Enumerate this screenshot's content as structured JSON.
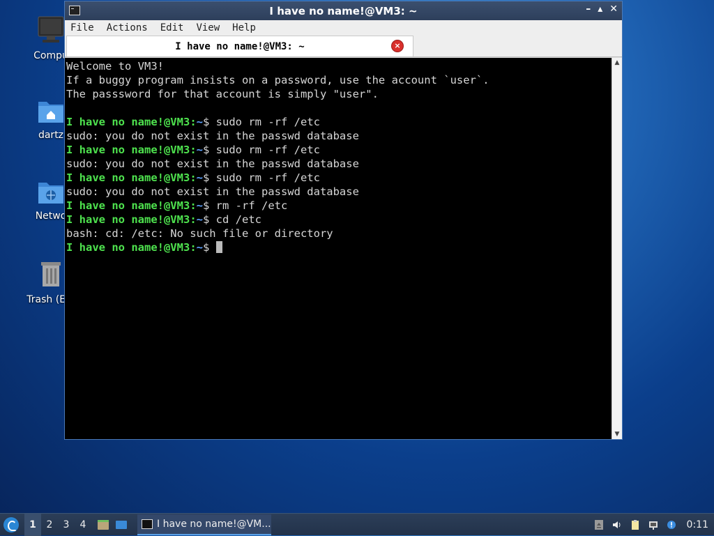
{
  "desktop": {
    "icons": [
      {
        "label": "Compu",
        "icon": "computer-icon"
      },
      {
        "label": "dartz",
        "icon": "home-folder-icon"
      },
      {
        "label": "Netwo",
        "icon": "network-folder-icon"
      },
      {
        "label": "Trash (Em",
        "icon": "trash-icon"
      }
    ]
  },
  "window": {
    "title": "I have no name!@VM3: ~",
    "buttons": {
      "minimize": "–",
      "maximize": "▴",
      "close": "✕"
    },
    "menu": [
      "File",
      "Actions",
      "Edit",
      "View",
      "Help"
    ],
    "tab": {
      "label": "I have no name!@VM3: ~",
      "close": "×"
    }
  },
  "terminal": {
    "lines": [
      {
        "type": "text",
        "text": "Welcome to VM3!"
      },
      {
        "type": "text",
        "text": "If a buggy program insists on a password, use the account `user`."
      },
      {
        "type": "text",
        "text": "The passsword for that account is simply \"user\"."
      },
      {
        "type": "text",
        "text": ""
      },
      {
        "type": "prompt",
        "user": "I have no name!@VM3",
        "path": "~",
        "cmd": "sudo rm -rf /etc"
      },
      {
        "type": "text",
        "text": "sudo: you do not exist in the passwd database"
      },
      {
        "type": "prompt",
        "user": "I have no name!@VM3",
        "path": "~",
        "cmd": "sudo rm -rf /etc"
      },
      {
        "type": "text",
        "text": "sudo: you do not exist in the passwd database"
      },
      {
        "type": "prompt",
        "user": "I have no name!@VM3",
        "path": "~",
        "cmd": "sudo rm -rf /etc"
      },
      {
        "type": "text",
        "text": "sudo: you do not exist in the passwd database"
      },
      {
        "type": "prompt",
        "user": "I have no name!@VM3",
        "path": "~",
        "cmd": "rm -rf /etc"
      },
      {
        "type": "prompt",
        "user": "I have no name!@VM3",
        "path": "~",
        "cmd": "cd /etc"
      },
      {
        "type": "text",
        "text": "bash: cd: /etc: No such file or directory"
      },
      {
        "type": "prompt",
        "user": "I have no name!@VM3",
        "path": "~",
        "cmd": "",
        "cursor": true
      }
    ],
    "colors": {
      "prompt": "#4ee24e",
      "path": "#5ea3ff",
      "text": "#d6d6d6",
      "background": "#000000"
    }
  },
  "taskbar": {
    "workspaces": [
      "1",
      "2",
      "3",
      "4"
    ],
    "active_workspace": "1",
    "task_label": "I have no name!@VM...",
    "clock": "0:11"
  }
}
